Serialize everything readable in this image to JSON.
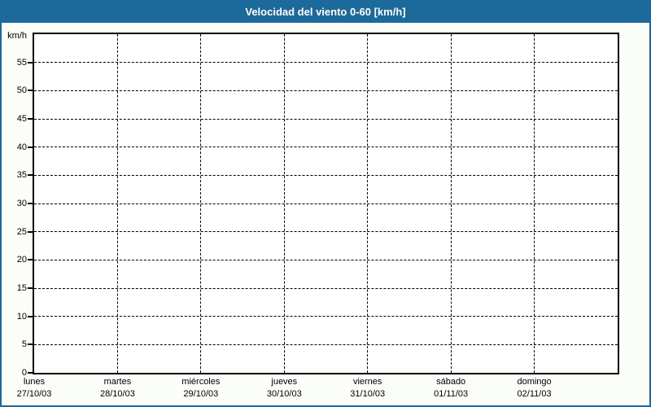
{
  "header": {
    "title": "Velocidad del viento 0-60 [km/h]"
  },
  "chart_data": {
    "type": "line",
    "title": "Velocidad del viento 0-60 [km/h]",
    "ylabel": "km/h",
    "xlabel": "",
    "ylim": [
      0,
      60
    ],
    "ytick_step": 5,
    "yticks": [
      0,
      5,
      10,
      15,
      20,
      25,
      30,
      35,
      40,
      45,
      50,
      55
    ],
    "categories": [
      {
        "day": "lunes",
        "date": "27/10/03"
      },
      {
        "day": "martes",
        "date": "28/10/03"
      },
      {
        "day": "miércoles",
        "date": "29/10/03"
      },
      {
        "day": "jueves",
        "date": "30/10/03"
      },
      {
        "day": "viernes",
        "date": "31/10/03"
      },
      {
        "day": "sábado",
        "date": "01/11/03"
      },
      {
        "day": "domingo",
        "date": "02/11/03"
      }
    ],
    "days_shown": 7,
    "series": [],
    "grid": "dashed-both-axes",
    "legend": "none"
  },
  "colors": {
    "header_bg": "#1c699c",
    "header_text": "#ffffff",
    "window_border": "#1c699c",
    "page_bg": "#fbfdf9",
    "plot_bg": "#ffffff",
    "plot_border": "#000000",
    "grid": "#000000",
    "text": "#000000"
  }
}
